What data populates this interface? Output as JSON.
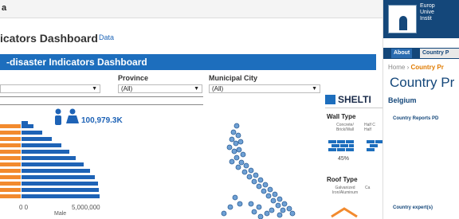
{
  "dashboard": {
    "top_title": "a",
    "title": "icators Dashboard",
    "data_link": "Data",
    "banner": "-disaster Indicators Dashboard",
    "filters": [
      {
        "label": "Province",
        "value": "(All)"
      },
      {
        "label": "Municipal City",
        "value": "(All)"
      }
    ],
    "left_select_value": "",
    "population_value": "100,979.3K",
    "axis_ticks": [
      "0 0",
      "5,000,000"
    ],
    "axis_label": "Male",
    "shelter_logo": "SHELTI",
    "wall_type": {
      "title": "Wall Type",
      "col1_label": "Concrete/ Brick/Wall",
      "col2_label": "Half C Half",
      "percent": "45%"
    },
    "roof_type": {
      "title": "Roof Type",
      "col1_label": "Galvanized Iron/Aluminum",
      "col2_label": "Ca"
    },
    "colors": {
      "accent_blue": "#1d6ebd",
      "orange": "#f28a2e",
      "bar_blue": "#1e63b6",
      "header_navy": "#14477a"
    }
  },
  "right_panel": {
    "institution_lines": [
      "Europ",
      "Unive",
      "Instit"
    ],
    "tabs": [
      "About",
      "Country P"
    ],
    "breadcrumb_home": "Home",
    "breadcrumb_sep": "›",
    "breadcrumb_current": "Country Pr",
    "title": "Country Pr",
    "country": "Belgium",
    "reports_label": "Country Reports PD",
    "experts_label": "Country expert(s)"
  }
}
